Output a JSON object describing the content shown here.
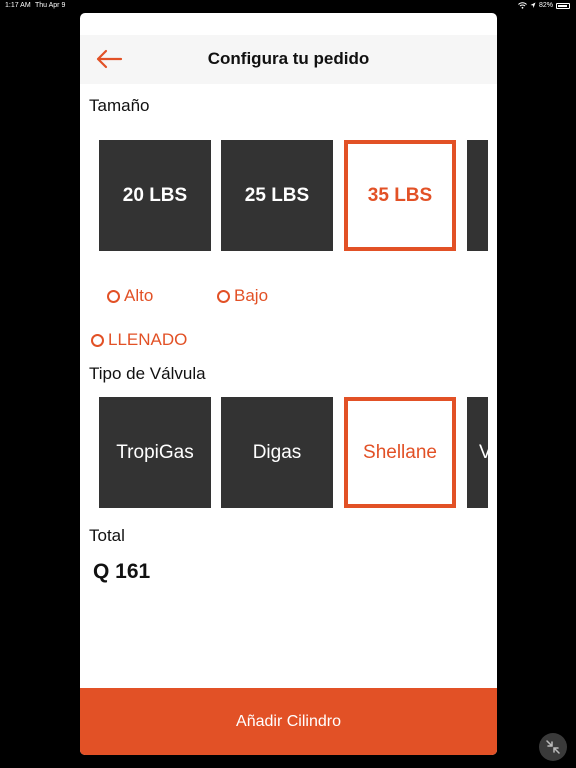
{
  "status_bar": {
    "time": "1:17 AM",
    "date": "Thu Apr 9",
    "battery": "82%"
  },
  "header": {
    "title": "Configura tu pedido"
  },
  "size_section": {
    "label": "Tamaño",
    "options": [
      {
        "label": "20 LBS",
        "selected": false
      },
      {
        "label": "25 LBS",
        "selected": false
      },
      {
        "label": "35 LBS",
        "selected": true
      }
    ]
  },
  "radios": {
    "alto": "Alto",
    "bajo": "Bajo",
    "llenado": "LLENADO"
  },
  "valve_section": {
    "label": "Tipo de Válvula",
    "options": [
      {
        "label": "TropiGas",
        "selected": false
      },
      {
        "label": "Digas",
        "selected": false
      },
      {
        "label": "Shellane",
        "selected": true
      },
      {
        "label": "V",
        "selected": false
      }
    ]
  },
  "total": {
    "label": "Total",
    "value": "Q 161"
  },
  "add_button": {
    "label": "Añadir Cilindro"
  },
  "colors": {
    "accent": "#e25126",
    "tile": "#333333",
    "header_bg": "#f6f6f6"
  }
}
